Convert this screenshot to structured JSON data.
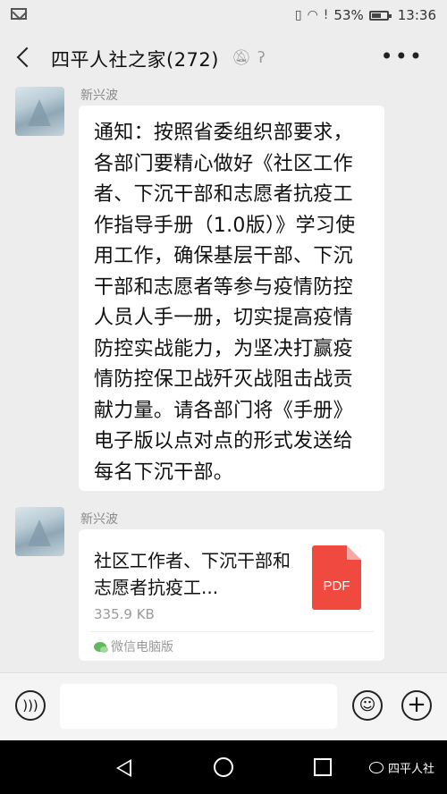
{
  "status_bar": {
    "battery_percent": "53%",
    "time": "13:36",
    "icons": [
      "mail-icon",
      "vibrate-icon",
      "wifi-icon",
      "alert-icon",
      "battery-icon"
    ]
  },
  "header": {
    "title": "四平人社之家(272)",
    "icons": [
      "back-icon",
      "mute-bell-icon",
      "ear-icon",
      "more-icon"
    ]
  },
  "messages": [
    {
      "sender": "新兴波",
      "text": "通知：按照省委组织部要求，各部门要精心做好《社区工作者、下沉干部和志愿者抗疫工作指导手册（1.0版）》学习使用工作，确保基层干部、下沉干部和志愿者等参与疫情防控人员人手一册，切实提高疫情防控实战能力，为坚决打赢疫情防控保卫战歼灭战阻击战贡献力量。请各部门将《手册》电子版以点对点的形式发送给每名下沉干部。"
    },
    {
      "sender": "新兴波",
      "file": {
        "name": "社区工作者、下沉干部和志愿者抗疫工...",
        "size": "335.9 KB",
        "type_label": "PDF",
        "source": "微信电脑版"
      }
    }
  ],
  "input_bar": {
    "icons": [
      "voice-icon",
      "emoji-icon",
      "plus-icon"
    ]
  },
  "nav_bar": {
    "watermark": "四平人社"
  },
  "colors": {
    "background": "#ededed",
    "bubble": "#ffffff",
    "pdf_red": "#f04a40",
    "wechat_green": "#62b95b"
  }
}
